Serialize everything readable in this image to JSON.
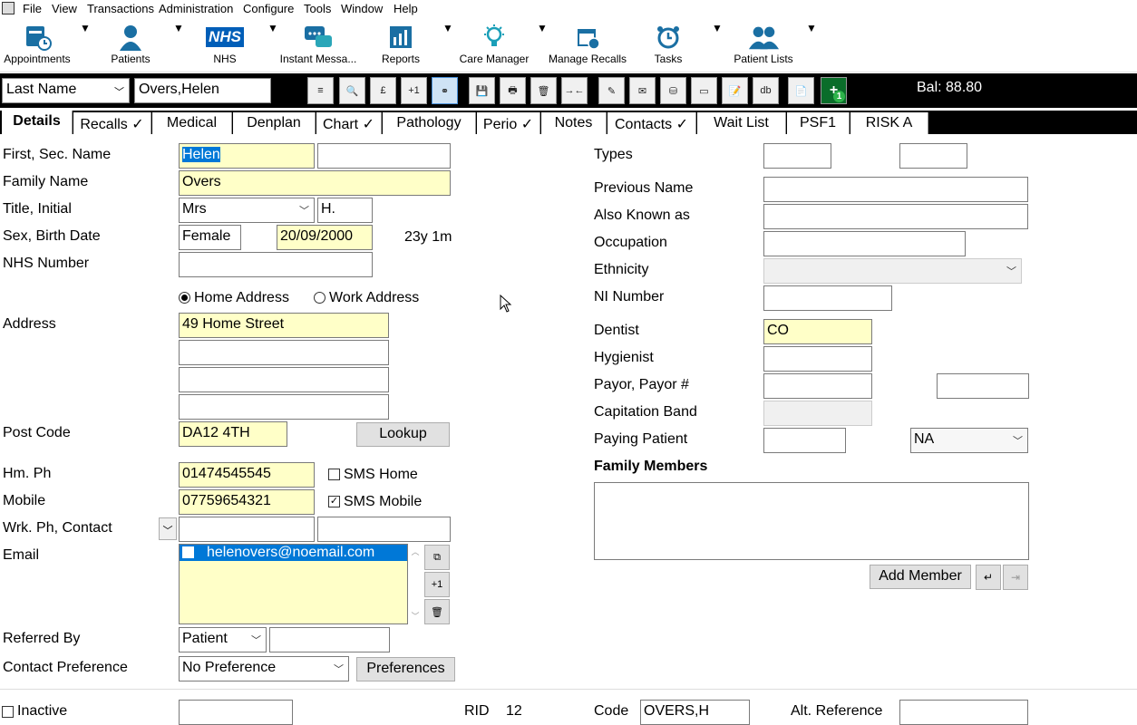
{
  "menu": [
    "File",
    "View",
    "Transactions",
    "Administration",
    "Configure",
    "Tools",
    "Window",
    "Help"
  ],
  "ribbon": [
    {
      "label": "Appointments",
      "icon": "appointments-icon"
    },
    {
      "label": "Patients",
      "icon": "patient-icon"
    },
    {
      "label": "NHS",
      "icon": "nhs-logo-icon"
    },
    {
      "label": "Instant Messa...",
      "icon": "chat-icon"
    },
    {
      "label": "Reports",
      "icon": "reports-icon"
    },
    {
      "label": "Care Manager",
      "icon": "lightbulb-icon"
    },
    {
      "label": "Manage Recalls",
      "icon": "calendar-icon"
    },
    {
      "label": "Tasks",
      "icon": "alarm-clock-icon"
    },
    {
      "label": "Patient Lists",
      "icon": "patient-group-icon"
    }
  ],
  "nhs_logo_text": "NHS",
  "toolbar": {
    "search_type": "Last Name",
    "search_value": "Overs,Helen",
    "balance": "Bal: 88.80",
    "buttons": [
      "≡",
      "🔍",
      "£",
      "+1",
      "⚭",
      "💾",
      "🖶",
      "🗑",
      "→←",
      "✎",
      "✉",
      "⛁",
      "▭",
      "📝",
      "db",
      "📄",
      "+"
    ],
    "notification_count": "1"
  },
  "tabs": [
    "Details",
    "Recalls ✓",
    "Medical",
    "Denplan",
    "Chart ✓",
    "Pathology",
    "Perio ✓",
    "Notes",
    "Contacts ✓",
    "Wait List",
    "PSF1",
    "RISK A"
  ],
  "form": {
    "labels": {
      "first_name": "First, Sec. Name",
      "family_name": "Family Name",
      "title": "Title, Initial",
      "sex": "Sex, Birth Date",
      "nhs": "NHS Number",
      "address": "Address",
      "postcode": "Post Code",
      "home_phone": "Hm. Ph",
      "mobile": "Mobile",
      "work_phone": "Wrk. Ph, Contact",
      "email": "Email",
      "referred_by": "Referred By",
      "contact_pref": "Contact Preference",
      "inactive": "Inactive",
      "rid": "RID",
      "code": "Code",
      "alt_ref": "Alt. Reference"
    },
    "first_name": "Helen",
    "second_name": "",
    "family_name": "Overs",
    "title": "Mrs",
    "initial": "H.",
    "sex": "Female",
    "birth_date": "20/09/2000",
    "age": "23y 1m",
    "nhs_number": "",
    "home_address_label": "Home Address",
    "work_address_label": "Work Address",
    "address_line1": "49 Home Street",
    "address_line2": "",
    "address_line3": "",
    "address_line4": "",
    "postcode": "DA12 4TH",
    "lookup_label": "Lookup",
    "home_phone": "01474545545",
    "sms_home_label": "SMS Home",
    "mobile": "07759654321",
    "sms_mobile_label": "SMS Mobile",
    "work_phone": "",
    "contact": "",
    "email": "helenovers@noemail.com",
    "email_btns": [
      "⧉",
      "+1",
      "🗑"
    ],
    "referred_by": "Patient",
    "referred_by_detail": "",
    "contact_preference": "No Preference",
    "preferences_label": "Preferences",
    "rid_value": "12",
    "code_value": "OVERS,H",
    "alt_reference": ""
  },
  "right": {
    "labels": {
      "types": "Types",
      "prev_name": "Previous Name",
      "aka": "Also Known as",
      "occupation": "Occupation",
      "ethnicity": "Ethnicity",
      "ni": "NI Number",
      "dentist": "Dentist",
      "hygienist": "Hygienist",
      "payor": "Payor, Payor #",
      "capitation": "Capitation Band",
      "paying": "Paying Patient",
      "family": "Family Members"
    },
    "dentist": "CO",
    "paying_select": "NA",
    "add_member_label": "Add Member"
  },
  "colors": {
    "field_yellow": "#ffffc8",
    "toolbar_bg": "#000000",
    "email_selected": "#0078d7"
  }
}
